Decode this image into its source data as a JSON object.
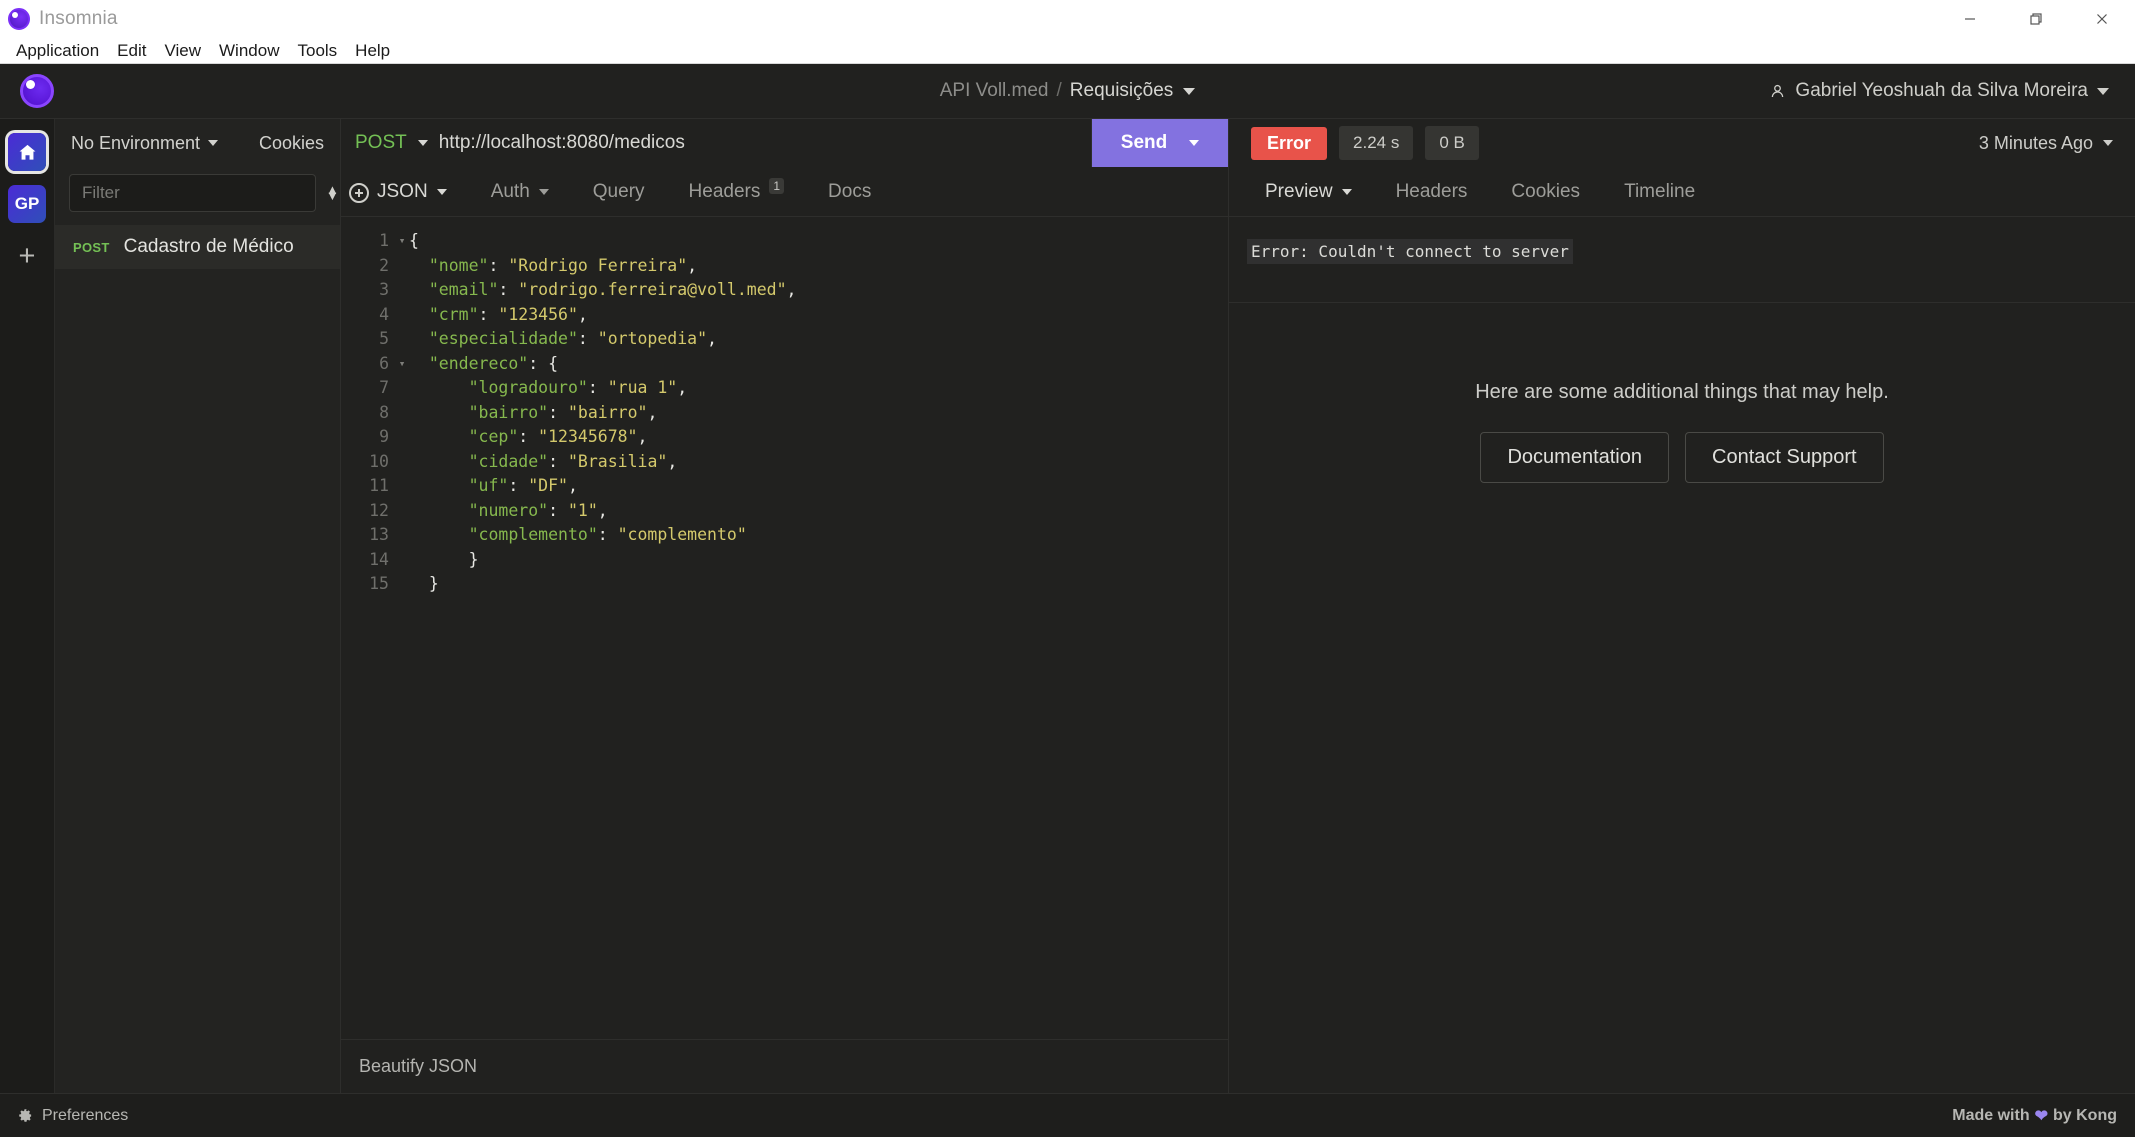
{
  "window": {
    "app_title": "Insomnia",
    "logo_icon": "insomnia-logo-icon",
    "controls": {
      "minimize": "minimize-icon",
      "restore": "restore-icon",
      "close": "close-icon"
    }
  },
  "menubar": {
    "items": [
      {
        "label": "Application"
      },
      {
        "label": "Edit"
      },
      {
        "label": "View"
      },
      {
        "label": "Window"
      },
      {
        "label": "Tools"
      },
      {
        "label": "Help"
      }
    ]
  },
  "app_header": {
    "project": "API Voll.med",
    "separator": "/",
    "folder": "Requisições",
    "user": "Gabriel Yeoshuah da Silva Moreira",
    "user_icon": "user-icon"
  },
  "rail": {
    "home_icon": "home-icon",
    "workspace_avatar": "GP",
    "add_label": "+"
  },
  "sidebar": {
    "environment": "No Environment",
    "cookies": "Cookies",
    "filter_placeholder": "Filter",
    "filter_value": "",
    "sort_icon": "sort-icon",
    "add_icon": "add-circle-icon",
    "requests": [
      {
        "method": "POST",
        "name": "Cadastro de Médico",
        "selected": true
      }
    ]
  },
  "request": {
    "method": "POST",
    "url": "http://localhost:8080/medicos",
    "send_label": "Send",
    "tabs": [
      {
        "label": "JSON",
        "has_caret": true,
        "active": true,
        "badge": ""
      },
      {
        "label": "Auth",
        "has_caret": true,
        "active": false,
        "badge": ""
      },
      {
        "label": "Query",
        "has_caret": false,
        "active": false,
        "badge": ""
      },
      {
        "label": "Headers",
        "has_caret": false,
        "active": false,
        "badge": "1"
      },
      {
        "label": "Docs",
        "has_caret": false,
        "active": false,
        "badge": ""
      }
    ],
    "beautify_label": "Beautify JSON",
    "body_lines": [
      {
        "n": "1",
        "fold": "▾",
        "segments": [
          {
            "t": "{",
            "c": "p"
          }
        ]
      },
      {
        "n": "2",
        "fold": "",
        "segments": [
          {
            "t": "  ",
            "c": "p"
          },
          {
            "t": "\"nome\"",
            "c": "k"
          },
          {
            "t": ": ",
            "c": "p"
          },
          {
            "t": "\"Rodrigo Ferreira\"",
            "c": "s"
          },
          {
            "t": ",",
            "c": "p"
          }
        ]
      },
      {
        "n": "3",
        "fold": "",
        "segments": [
          {
            "t": "  ",
            "c": "p"
          },
          {
            "t": "\"email\"",
            "c": "k"
          },
          {
            "t": ": ",
            "c": "p"
          },
          {
            "t": "\"rodrigo.ferreira@voll.med\"",
            "c": "s"
          },
          {
            "t": ",",
            "c": "p"
          }
        ]
      },
      {
        "n": "4",
        "fold": "",
        "segments": [
          {
            "t": "  ",
            "c": "p"
          },
          {
            "t": "\"crm\"",
            "c": "k"
          },
          {
            "t": ": ",
            "c": "p"
          },
          {
            "t": "\"123456\"",
            "c": "s"
          },
          {
            "t": ",",
            "c": "p"
          }
        ]
      },
      {
        "n": "5",
        "fold": "",
        "segments": [
          {
            "t": "  ",
            "c": "p"
          },
          {
            "t": "\"especialidade\"",
            "c": "k"
          },
          {
            "t": ": ",
            "c": "p"
          },
          {
            "t": "\"ortopedia\"",
            "c": "s"
          },
          {
            "t": ",",
            "c": "p"
          }
        ]
      },
      {
        "n": "6",
        "fold": "▾",
        "segments": [
          {
            "t": "  ",
            "c": "p"
          },
          {
            "t": "\"endereco\"",
            "c": "k"
          },
          {
            "t": ": ",
            "c": "p"
          },
          {
            "t": "{",
            "c": "p"
          }
        ]
      },
      {
        "n": "7",
        "fold": "",
        "segments": [
          {
            "t": "      ",
            "c": "p"
          },
          {
            "t": "\"logradouro\"",
            "c": "k"
          },
          {
            "t": ": ",
            "c": "p"
          },
          {
            "t": "\"rua 1\"",
            "c": "s"
          },
          {
            "t": ",",
            "c": "p"
          }
        ]
      },
      {
        "n": "8",
        "fold": "",
        "segments": [
          {
            "t": "      ",
            "c": "p"
          },
          {
            "t": "\"bairro\"",
            "c": "k"
          },
          {
            "t": ": ",
            "c": "p"
          },
          {
            "t": "\"bairro\"",
            "c": "s"
          },
          {
            "t": ",",
            "c": "p"
          }
        ]
      },
      {
        "n": "9",
        "fold": "",
        "segments": [
          {
            "t": "      ",
            "c": "p"
          },
          {
            "t": "\"cep\"",
            "c": "k"
          },
          {
            "t": ": ",
            "c": "p"
          },
          {
            "t": "\"12345678\"",
            "c": "s"
          },
          {
            "t": ",",
            "c": "p"
          }
        ]
      },
      {
        "n": "10",
        "fold": "",
        "segments": [
          {
            "t": "      ",
            "c": "p"
          },
          {
            "t": "\"cidade\"",
            "c": "k"
          },
          {
            "t": ": ",
            "c": "p"
          },
          {
            "t": "\"Brasilia\"",
            "c": "s"
          },
          {
            "t": ",",
            "c": "p"
          }
        ]
      },
      {
        "n": "11",
        "fold": "",
        "segments": [
          {
            "t": "      ",
            "c": "p"
          },
          {
            "t": "\"uf\"",
            "c": "k"
          },
          {
            "t": ": ",
            "c": "p"
          },
          {
            "t": "\"DF\"",
            "c": "s"
          },
          {
            "t": ",",
            "c": "p"
          }
        ]
      },
      {
        "n": "12",
        "fold": "",
        "segments": [
          {
            "t": "      ",
            "c": "p"
          },
          {
            "t": "\"numero\"",
            "c": "k"
          },
          {
            "t": ": ",
            "c": "p"
          },
          {
            "t": "\"1\"",
            "c": "s"
          },
          {
            "t": ",",
            "c": "p"
          }
        ]
      },
      {
        "n": "13",
        "fold": "",
        "segments": [
          {
            "t": "      ",
            "c": "p"
          },
          {
            "t": "\"complemento\"",
            "c": "k"
          },
          {
            "t": ": ",
            "c": "p"
          },
          {
            "t": "\"complemento\"",
            "c": "s"
          }
        ]
      },
      {
        "n": "14",
        "fold": "",
        "segments": [
          {
            "t": "      ",
            "c": "p"
          },
          {
            "t": "}",
            "c": "p"
          }
        ]
      },
      {
        "n": "15",
        "fold": "",
        "segments": [
          {
            "t": "  ",
            "c": "p"
          },
          {
            "t": "}",
            "c": "p"
          }
        ]
      }
    ]
  },
  "response": {
    "status_label": "Error",
    "time_label": "2.24 s",
    "size_label": "0 B",
    "history_label": "3 Minutes Ago",
    "tabs": [
      {
        "label": "Preview",
        "has_caret": true,
        "active": true
      },
      {
        "label": "Headers",
        "has_caret": false,
        "active": false
      },
      {
        "label": "Cookies",
        "has_caret": false,
        "active": false
      },
      {
        "label": "Timeline",
        "has_caret": false,
        "active": false
      }
    ],
    "error_message": "Error: Couldn't connect to server",
    "help_text": "Here are some additional things that may help.",
    "help_buttons": [
      {
        "label": "Documentation"
      },
      {
        "label": "Contact Support"
      }
    ]
  },
  "footer": {
    "preferences_label": "Preferences",
    "gear_icon": "gear-icon",
    "made_with_prefix": "Made with",
    "heart_icon": "heart-icon",
    "made_with_suffix": "by Kong"
  },
  "colors": {
    "accent_purple": "#8372e0",
    "error_red": "#e8534a",
    "method_green": "#74c055",
    "json_key": "#86b84e",
    "json_string": "#d4c96c",
    "bg_dark": "#21211f"
  }
}
